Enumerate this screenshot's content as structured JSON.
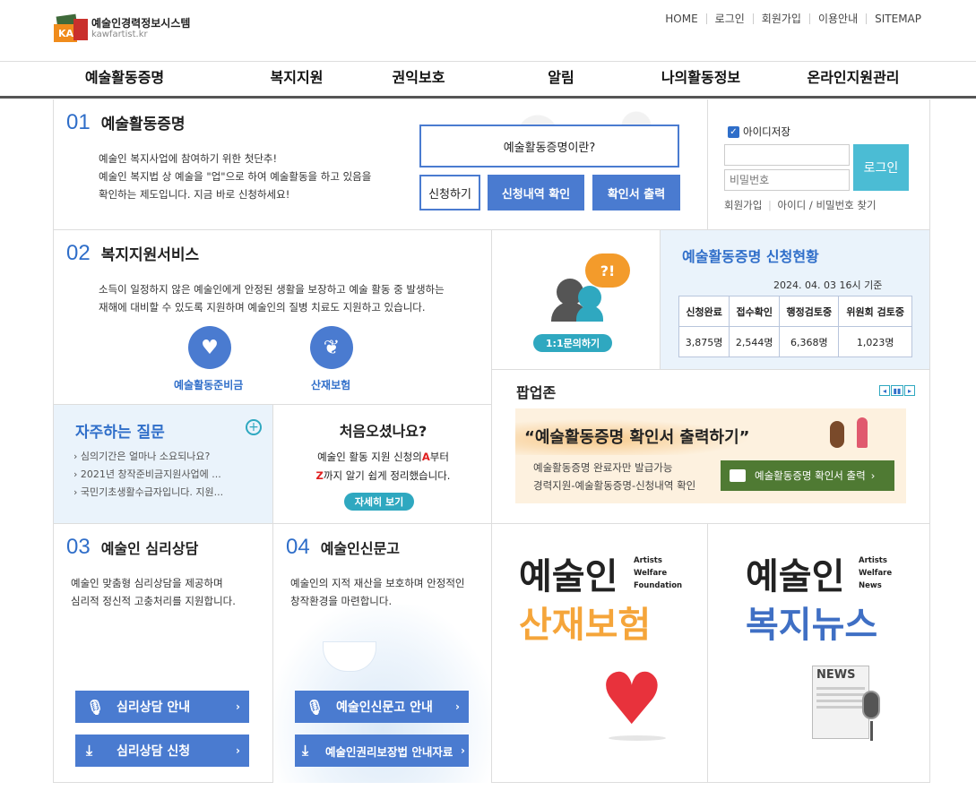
{
  "header": {
    "logo_title": "예술인경력정보시스템",
    "logo_sub": "kawfartist.kr",
    "logo_mark": "KA",
    "top_links": [
      "HOME",
      "로그인",
      "회원가입",
      "이용안내",
      "SITEMAP"
    ]
  },
  "gnb": [
    "예술활동증명",
    "복지지원",
    "권익보호",
    "알림",
    "나의활동정보",
    "온라인지원관리"
  ],
  "s01": {
    "num": "01",
    "title": "예술활동증명",
    "desc": [
      "예술인 복지사업에 참여하기 위한 첫단추!",
      "예술인 복지법 상 예술을 \"업\"으로 하여 예술활동을 하고 있음을",
      "확인하는 제도입니다. 지금 바로 신청하세요!"
    ],
    "what_btn": "예술활동증명이란?",
    "apply_btn": "신청하기",
    "check_btn": "신청내역 확인",
    "print_btn": "확인서 출력"
  },
  "login": {
    "save_id": "아이디저장",
    "pw_placeholder": "비밀번호",
    "login_btn": "로그인",
    "links": [
      "회원가입",
      "아이디 / 비밀번호 찾기"
    ]
  },
  "s02": {
    "num": "02",
    "title": "복지지원서비스",
    "desc": [
      "소득이 일정하지 않은 예술인에게 안정된 생활을 보장하고 예술 활동 중 발생하는",
      "재해에 대비할 수 있도록 지원하며 예술인의 질병 치료도 지원하고 있습니다."
    ],
    "items": [
      "예술활동준비금",
      "산재보험"
    ]
  },
  "inquiry": {
    "bubble": "?!",
    "btn": "1:1문의하기"
  },
  "status": {
    "title": "예술활동증명 신청현황",
    "date": "2024. 04. 03   16시 기준",
    "headers": [
      "신청완료",
      "접수확인",
      "행정검토중",
      "위원회 검토중"
    ],
    "values": [
      "3,875명",
      "2,544명",
      "6,368명",
      "1,023명"
    ]
  },
  "popup": {
    "title": "팝업존",
    "banner_title": "“예술활동증명 확인서 출력하기”",
    "line1": "예술활동증명 완료자만 발급가능",
    "line2": "경력지원-예술활동증명-신청내역 확인",
    "btn": "예술활동증명 확인서 출력"
  },
  "faq": {
    "title": "자주하는 질문",
    "items": [
      "심의기간은 얼마나 소요되나요?",
      "2021년 창작준비금지원사업에 ...",
      "국민기초생활수급자입니다. 지원..."
    ]
  },
  "first": {
    "title": "처음오셨나요?",
    "line1_a": "예술인 활동 지원 신청의",
    "line1_b": "A",
    "line1_c": "부터",
    "line2_a": "Z",
    "line2_b": "까지 알기 쉽게 정리했습니다.",
    "btn": "자세히 보기"
  },
  "s03": {
    "num": "03",
    "title": "예술인 심리상담",
    "desc": [
      "예술인 맞춤형 심리상담을 제공하며",
      "심리적 정신적 고충처리를 지원합니다."
    ],
    "btn1": "심리상담 안내",
    "btn2": "심리상담 신청"
  },
  "s04": {
    "num": "04",
    "title": "예술인신문고",
    "desc": [
      "예술인의 지적 재산을 보호하며 안정적인",
      "창작환경을 마련합니다."
    ],
    "btn1": "예술인신문고 안내",
    "btn2": "예술인권리보장법 안내자료"
  },
  "banner1": {
    "big": "예술인",
    "sub": [
      "Artists",
      "Welfare",
      "Foundation"
    ],
    "title": "산재보험"
  },
  "banner2": {
    "big": "예술인",
    "sub": [
      "Artists",
      "Welfare",
      "News"
    ],
    "title": "복지뉴스",
    "news": "NEWS"
  },
  "colors": {
    "accent": "#2f6ec9",
    "button": "#4a7bd0",
    "orange": "#f39b2b",
    "teal": "#2fa8c0",
    "green": "#4f7a33"
  }
}
